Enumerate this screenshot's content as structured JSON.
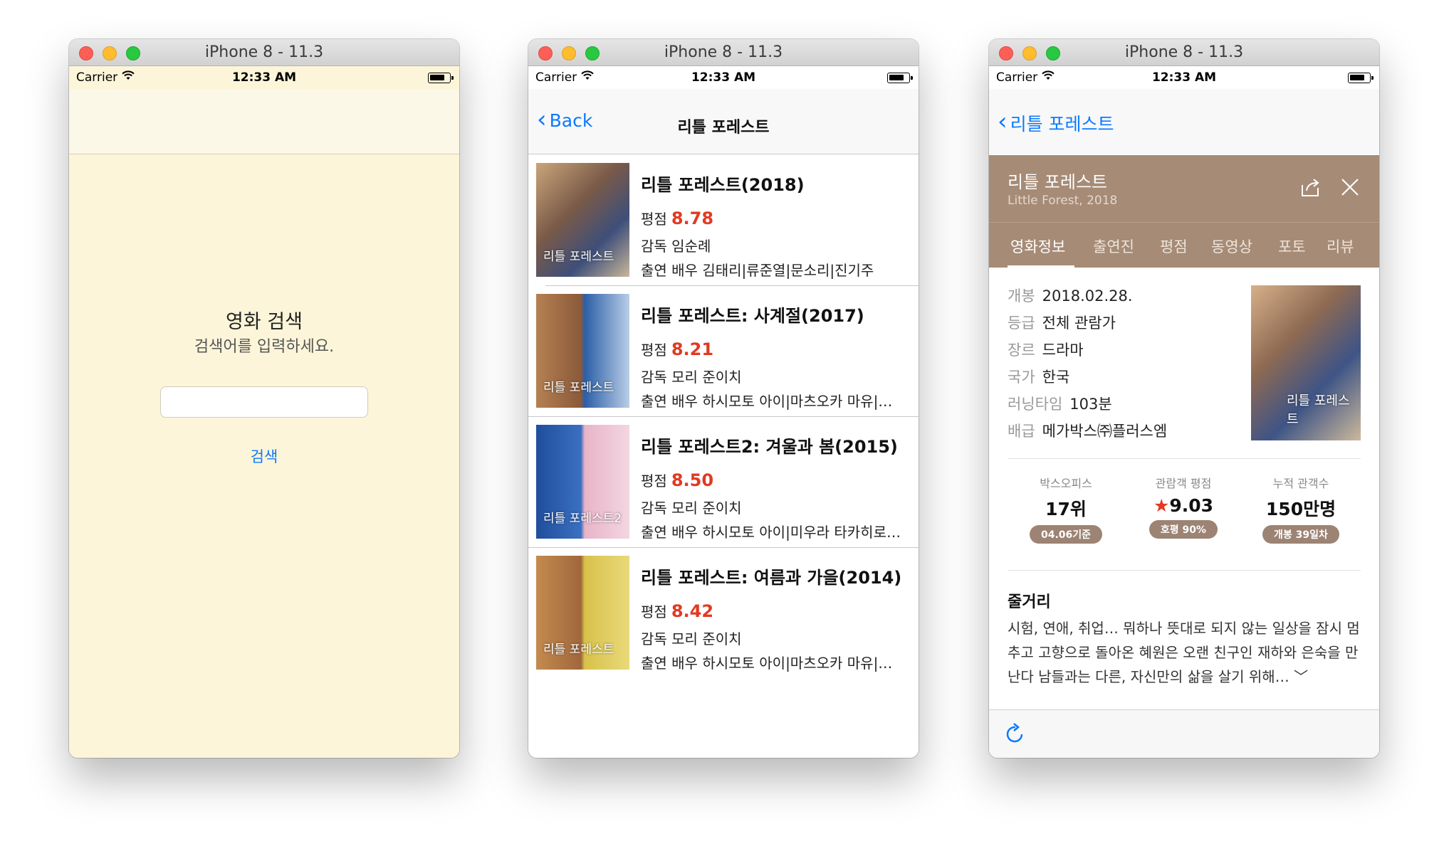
{
  "simulators": {
    "window_title": "iPhone 8 - 11.3",
    "status": {
      "carrier": "Carrier",
      "time": "12:33 AM"
    }
  },
  "screen1": {
    "title": "영화 검색",
    "subtitle": "검색어를 입력하세요.",
    "input_value": "",
    "search_button": "검색",
    "background": "#fcf5d9"
  },
  "screen2": {
    "back_label": "Back",
    "nav_title": "리틀 포레스트",
    "rating_label": "평점",
    "movies": [
      {
        "title": "리틀 포레스트(2018)",
        "rating": "8.78",
        "director": "감독 임순례",
        "cast": "출연 배우 김태리|류준열|문소리|진기주",
        "poster_caption": "리틀 포레스트"
      },
      {
        "title": "리틀 포레스트: 사계절(2017)",
        "rating": "8.21",
        "director": "감독 모리 준이치",
        "cast": "출연 배우 하시모토 아이|마츠오카 마유|…",
        "poster_caption": "리틀 포레스트"
      },
      {
        "title": "리틀 포레스트2: 겨울과 봄(2015)",
        "rating": "8.50",
        "director": "감독 모리 준이치",
        "cast": "출연 배우 하시모토 아이|미우라 타카히로…",
        "poster_caption": "리틀 포레스트2"
      },
      {
        "title": "리틀 포레스트: 여름과 가을(2014)",
        "rating": "8.42",
        "director": "감독 모리 준이치",
        "cast": "출연 배우 하시모토 아이|마츠오카 마유|…",
        "poster_caption": "리틀 포레스트"
      }
    ],
    "score_color": "#e23a22"
  },
  "screen3": {
    "back_label": "리틀 포레스트",
    "header": {
      "title": "리틀 포레스트",
      "subtitle": "Little Forest, 2018"
    },
    "tabs": [
      "영화정보",
      "출연진",
      "평점",
      "동영상",
      "포토",
      "리뷰"
    ],
    "info": [
      {
        "key": "개봉",
        "value": "2018.02.28."
      },
      {
        "key": "등급",
        "value": "전체 관람가"
      },
      {
        "key": "장르",
        "value": "드라마"
      },
      {
        "key": "국가",
        "value": "한국"
      },
      {
        "key": "러닝타임",
        "value": "103분"
      },
      {
        "key": "배급",
        "value": "메가박스㈜플러스엠"
      }
    ],
    "poster_caption": "리틀 포레스트",
    "stats": [
      {
        "label": "박스오피스",
        "value": "17위",
        "badge": "04.06기준"
      },
      {
        "label": "관람객 평점",
        "star": "★",
        "value": "9.03",
        "badge": "호평 90%"
      },
      {
        "label": "누적 관객수",
        "value": "150만명",
        "badge": "개봉 39일차"
      }
    ],
    "plot_heading": "줄거리",
    "plot_text": "시험, 연애, 취업… 뭐하나 뜻대로 되지 않는 일상을 잠시 멈추고 고향으로 돌아온 혜원은 오랜 친구인 재하와 은숙을 만난다 남들과는 다른, 자신만의 삶을 살기 위해… ﹀",
    "header_color": "#a68b76",
    "badge_color": "#9c8373"
  }
}
